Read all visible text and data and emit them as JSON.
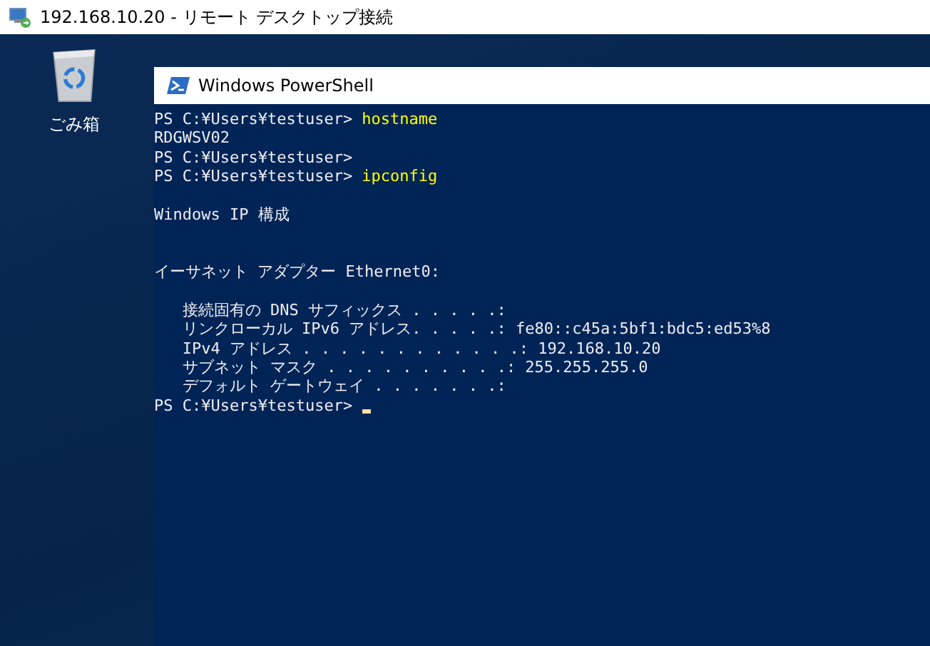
{
  "window": {
    "title": "192.168.10.20 - リモート デスクトップ接続"
  },
  "desktop": {
    "icons": [
      {
        "label": "ごみ箱"
      }
    ]
  },
  "console": {
    "title": "Windows PowerShell",
    "lines": [
      {
        "kind": "prompt",
        "prompt": "PS C:¥Users¥testuser>",
        "command": "hostname"
      },
      {
        "kind": "output",
        "text": "RDGWSV02"
      },
      {
        "kind": "prompt",
        "prompt": "PS C:¥Users¥testuser>"
      },
      {
        "kind": "prompt",
        "prompt": "PS C:¥Users¥testuser>",
        "command": "ipconfig"
      },
      {
        "kind": "blank"
      },
      {
        "kind": "output",
        "text": "Windows IP 構成"
      },
      {
        "kind": "blank"
      },
      {
        "kind": "blank"
      },
      {
        "kind": "output",
        "text": "イーサネット アダプター Ethernet0:"
      },
      {
        "kind": "blank"
      },
      {
        "kind": "output",
        "text": "   接続固有の DNS サフィックス . . . . .:"
      },
      {
        "kind": "output",
        "text": "   リンクローカル IPv6 アドレス. . . . .: fe80::c45a:5bf1:bdc5:ed53%8"
      },
      {
        "kind": "output",
        "text": "   IPv4 アドレス . . . . . . . . . . . .: 192.168.10.20"
      },
      {
        "kind": "output",
        "text": "   サブネット マスク . . . . . . . . . .: 255.255.255.0"
      },
      {
        "kind": "output",
        "text": "   デフォルト ゲートウェイ . . . . . . .:"
      },
      {
        "kind": "prompt",
        "prompt": "PS C:¥Users¥testuser>",
        "cursor": true
      }
    ]
  }
}
